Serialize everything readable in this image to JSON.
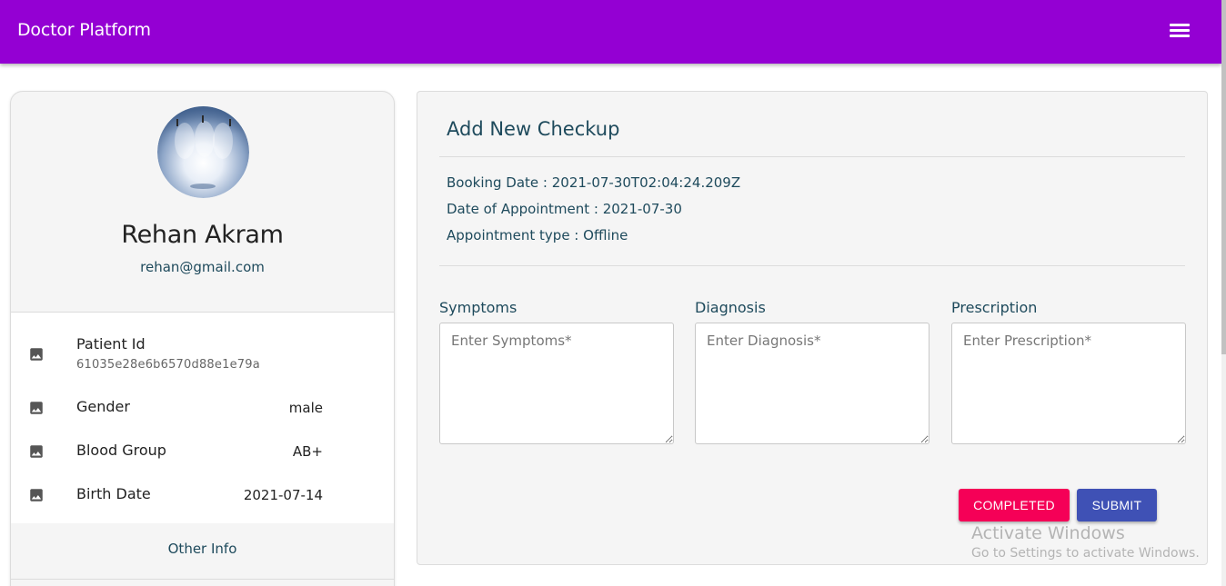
{
  "app": {
    "title": "Doctor Platform",
    "menu_icon": "hamburger-menu-icon",
    "brand_color": "#9400d3"
  },
  "profile": {
    "name": "Rehan Akram",
    "email": "rehan@gmail.com",
    "avatar_icon": "profile-photo",
    "fields": [
      {
        "label": "Patient Id",
        "value": "61035e28e6b6570d88e1e79a",
        "icon": "image-icon"
      },
      {
        "label": "Gender",
        "value": "male",
        "icon": "image-icon"
      },
      {
        "label": "Blood Group",
        "value": "AB+",
        "icon": "image-icon"
      },
      {
        "label": "Birth Date",
        "value": "2021-07-14",
        "icon": "image-icon"
      }
    ],
    "other_info_label": "Other Info"
  },
  "checkup": {
    "heading": "Add New Checkup",
    "booking_date": "Booking Date : 2021-07-30T02:04:24.209Z",
    "appointment_date": "Date of Appointment : 2021-07-30",
    "appointment_type": "Appointment type : Offline",
    "symptoms": {
      "label": "Symptoms",
      "placeholder": "Enter Symptoms*",
      "value": ""
    },
    "diagnosis": {
      "label": "Diagnosis",
      "placeholder": "Enter Diagnosis*",
      "value": ""
    },
    "prescription": {
      "label": "Prescription",
      "placeholder": "Enter Prescription*",
      "value": ""
    },
    "completed_label": "COMPLETED",
    "submit_label": "SUBMIT",
    "completed_color": "#f50057",
    "submit_color": "#3f51b5"
  },
  "watermark": {
    "line1": "Activate Windows",
    "line2": "Go to Settings to activate Windows."
  }
}
